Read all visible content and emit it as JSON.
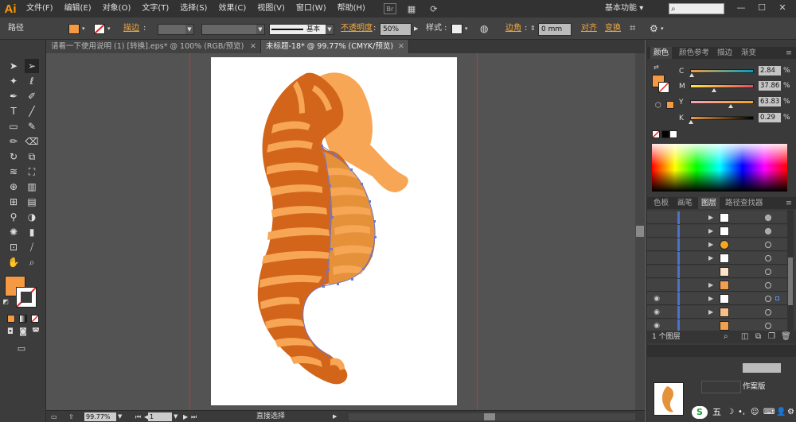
{
  "app": {
    "logo": "Ai",
    "workspace": "基本功能",
    "workspace_arrow": "▾"
  },
  "menu": [
    "文件(F)",
    "编辑(E)",
    "对象(O)",
    "文字(T)",
    "选择(S)",
    "效果(C)",
    "视图(V)",
    "窗口(W)",
    "帮助(H)"
  ],
  "control": {
    "object_type": "路径",
    "stroke_label": "描边",
    "stroke_line_label": "基本",
    "opacity_label": "不透明度",
    "opacity_value": "50%",
    "style_label": "样式",
    "corner_label": "边角",
    "corner_value": "0 mm",
    "align_label": "对齐",
    "transform_label": "变换",
    "fill_color": "#f59a42"
  },
  "tabs": [
    {
      "label": "请看一下使用说明 (1) [转换].eps* @ 100% (RGB/预览)",
      "active": false
    },
    {
      "label": "未标题-18* @ 99.77% (CMYK/预览)",
      "active": true
    }
  ],
  "status": {
    "zoom": "99.77%",
    "page": "1",
    "tool_name": "直接选择"
  },
  "color_panel": {
    "tabs": [
      "颜色",
      "颜色参考",
      "描边",
      "渐变"
    ],
    "channels": [
      {
        "label": "C",
        "value": "2.84",
        "unit": "%",
        "level": 0.03,
        "grad": "linear-gradient(to right,#f59a42,#00a0c0)"
      },
      {
        "label": "M",
        "value": "37.86",
        "unit": "%",
        "level": 0.38,
        "grad": "linear-gradient(to right,#ffe842,#e94a60)"
      },
      {
        "label": "Y",
        "value": "63.83",
        "unit": "%",
        "level": 0.64,
        "grad": "linear-gradient(to right,#f8a0c0,#f5a020)"
      },
      {
        "label": "K",
        "value": "0.29",
        "unit": "%",
        "level": 0.01,
        "grad": "linear-gradient(to right,#f59a42,#000000)"
      }
    ]
  },
  "layers_panel": {
    "tabs": [
      "色板",
      "画笔",
      "图层",
      "路径查找器"
    ],
    "footer_text": "1 个图层"
  },
  "bottom_panel": {
    "label": "作案版"
  },
  "ime": {
    "label": "五"
  }
}
